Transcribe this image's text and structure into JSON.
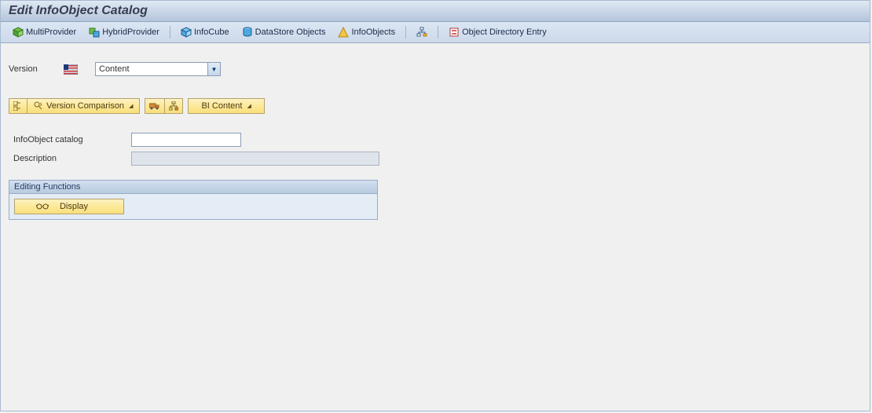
{
  "header": {
    "title": "Edit InfoObject Catalog"
  },
  "toolbar": {
    "multiprovider": "MultiProvider",
    "hybridprovider": "HybridProvider",
    "infocube": "InfoCube",
    "datastore": "DataStore Objects",
    "infoobjects": "InfoObjects",
    "objdir": "Object Directory Entry"
  },
  "version": {
    "label": "Version",
    "value": "Content"
  },
  "buttons": {
    "version_comparison": "Version Comparison",
    "bi_content": "BI Content"
  },
  "form": {
    "catalog_label": "InfoObject catalog",
    "catalog_value": "",
    "desc_label": "Description",
    "desc_value": ""
  },
  "panel": {
    "title": "Editing Functions",
    "display": "Display"
  }
}
